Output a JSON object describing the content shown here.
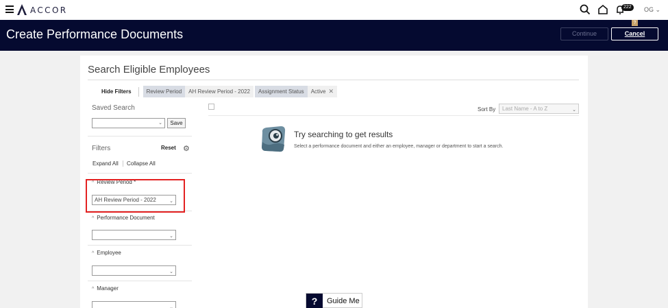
{
  "header": {
    "brand": "ACCOR",
    "notifications_count": "222",
    "user_initials": "OG",
    "help_marker": "?"
  },
  "titlebar": {
    "title": "Create Performance Documents",
    "continue_label": "Continue",
    "cancel_label": "Cancel"
  },
  "main": {
    "section_title": "Search Eligible Employees",
    "hide_filters_label": "Hide Filters",
    "chips": [
      {
        "label": "Review Period",
        "value": "AH Review Period - 2022"
      },
      {
        "label": "Assignment Status",
        "value": "Active"
      }
    ],
    "saved_search_label": "Saved Search",
    "save_label": "Save",
    "filters_label": "Filters",
    "reset_label": "Reset",
    "expand_all_label": "Expand All",
    "collapse_all_label": "Collapse All",
    "filter_groups": [
      {
        "title": "Review Period *",
        "value": "AH Review Period - 2022"
      },
      {
        "title": "Performance Document",
        "value": ""
      },
      {
        "title": "Employee",
        "value": ""
      },
      {
        "title": "Manager",
        "value": ""
      }
    ],
    "sort_by_label": "Sort By",
    "sort_value": "Last Name - A to Z",
    "empty_title": "Try searching to get results",
    "empty_subtitle": "Select a performance document and either an employee, manager or department to start a search."
  },
  "guide": {
    "icon_text": "?",
    "label": "Guide Me"
  },
  "colors": {
    "title_band": "#050a30",
    "highlight_border": "#e32020"
  }
}
